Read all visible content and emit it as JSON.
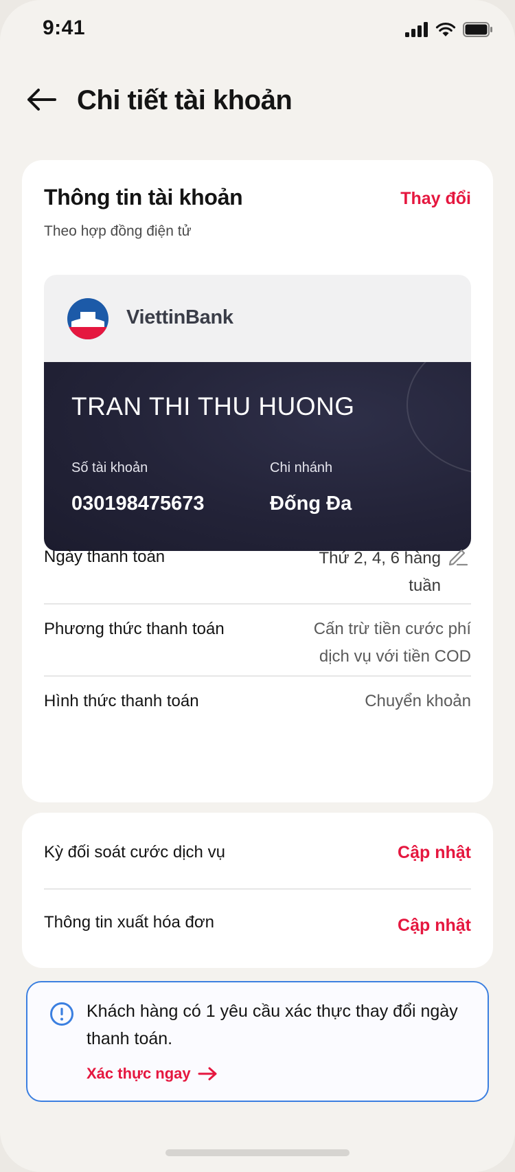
{
  "status_bar": {
    "time": "9:41"
  },
  "header": {
    "title": "Chi tiết tài khoản"
  },
  "account_info": {
    "title": "Thông tin tài khoản",
    "change_label": "Thay đổi",
    "subtitle": "Theo hợp đồng điện tử",
    "bank_card": {
      "bank_name": "ViettinBank",
      "holder_name": "TRAN THI THU HUONG",
      "account_number_label": "Số tài khoản",
      "account_number": "030198475673",
      "branch_label": "Chi nhánh",
      "branch": "Đống Đa"
    },
    "rows": [
      {
        "label": "Ngày thanh toán",
        "value_line1": "Thứ 2, 4, 6 hàng",
        "value_line2": "tuần"
      },
      {
        "label": "Phương thức thanh toán",
        "value_line1": "Cấn trừ tiền cước phí",
        "value_line2": "dịch vụ với tiền COD"
      },
      {
        "label": "Hình thức thanh toán",
        "value_line1": "Chuyển khoản"
      }
    ]
  },
  "settings": {
    "items": [
      {
        "label": "Kỳ đối soát cước dịch vụ",
        "action": "Cập nhật"
      },
      {
        "label": "Thông tin xuất hóa đơn",
        "action": "Cập nhật"
      }
    ]
  },
  "notice": {
    "text": "Khách hàng có 1 yêu cầu xác thực thay đổi ngày thanh toán.",
    "cta": "Xác thực ngay"
  },
  "colors": {
    "accent": "#e5173f",
    "info_border": "#3b7fe0",
    "card_dark": "#232338",
    "background": "#f4f2ee"
  }
}
